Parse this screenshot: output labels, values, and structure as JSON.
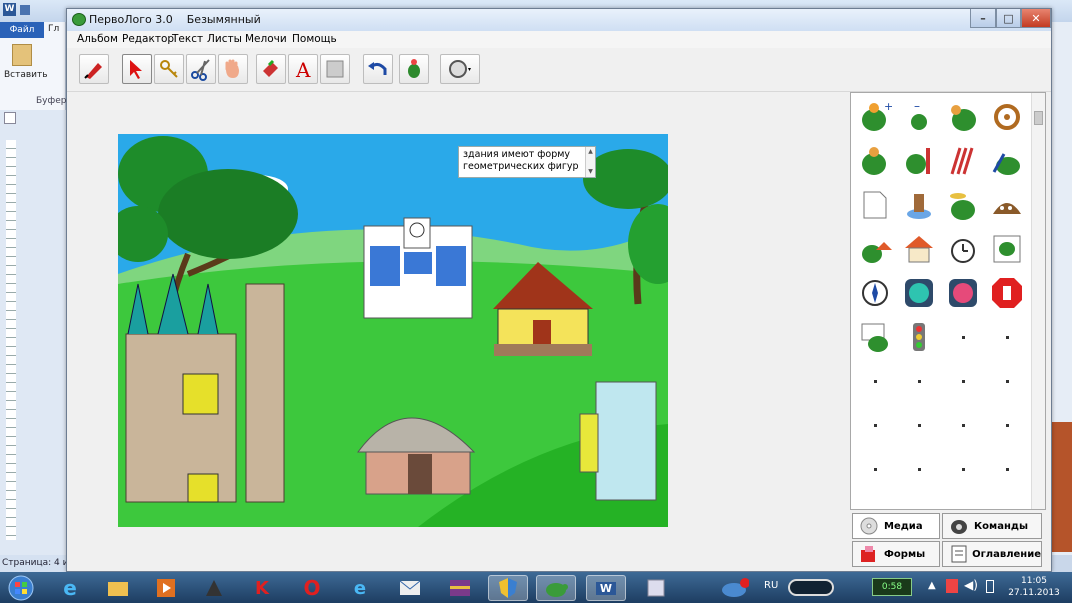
{
  "word": {
    "file_tab": "Файл",
    "home_tab_partial": "Гл",
    "paste_label": "Вставить",
    "clipboard_label": "Буфер",
    "status_text": "Страница: 4 и"
  },
  "app": {
    "title": "ПервоЛого 3.0",
    "document": "Безымянный",
    "menu": [
      "Альбом",
      "Редактор",
      "Текст",
      "Листы",
      "Мелочи",
      "Помощь"
    ],
    "toolbar_icons": [
      "brush-icon",
      "arrow-icon",
      "key-icon",
      "scissors-icon",
      "hand-icon",
      "eraser-icon",
      "text-a-icon",
      "square-icon",
      "undo-icon",
      "turtle-icon",
      "circle-dropdown-icon"
    ]
  },
  "canvas": {
    "textbox_line1": "здания имеют форму",
    "textbox_line2": "геометрических фигур",
    "scroll_up": "▲",
    "scroll_down": "▼"
  },
  "panel": {
    "tabs": {
      "media": "Медиа",
      "commands": "Команды",
      "shapes": "Формы",
      "contents": "Оглавление"
    }
  },
  "taskbar": {
    "lang": "RU",
    "timer": "0:58",
    "time": "11:05",
    "date": "27.11.2013"
  },
  "colors": {
    "sky": "#29a9e8",
    "grass": "#2fc62f",
    "tree_green": "#1e8c2a",
    "taskbar": "#274c74"
  }
}
